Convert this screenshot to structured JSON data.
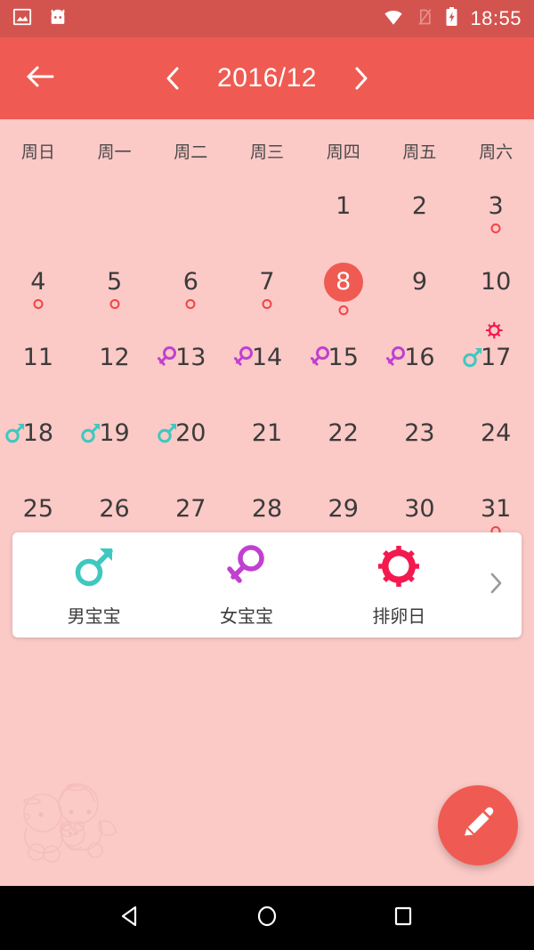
{
  "statusbar": {
    "time": "18:55",
    "icons": [
      "screenshot-icon",
      "android-head-icon",
      "wifi-icon",
      "sim-card-off-icon",
      "battery-charging-icon"
    ]
  },
  "appbar": {
    "back_icon": "arrow-left-icon",
    "prev_icon": "chevron-left-icon",
    "next_icon": "chevron-right-icon",
    "month_title": "2016/12",
    "background": "#ef5b52"
  },
  "calendar": {
    "weekdays": [
      "周日",
      "周一",
      "周二",
      "周三",
      "周四",
      "周五",
      "周六"
    ],
    "leading_blanks": 4,
    "background": "#fbc9c6",
    "today": 8,
    "days": [
      {
        "n": 1
      },
      {
        "n": 2
      },
      {
        "n": 3,
        "dot": true
      },
      {
        "n": 4,
        "dot": true
      },
      {
        "n": 5,
        "dot": true
      },
      {
        "n": 6,
        "dot": true
      },
      {
        "n": 7,
        "dot": true
      },
      {
        "n": 8,
        "dot": true,
        "today": true
      },
      {
        "n": 9
      },
      {
        "n": 10
      },
      {
        "n": 11
      },
      {
        "n": 12
      },
      {
        "n": 13,
        "mark": "female"
      },
      {
        "n": 14,
        "mark": "female"
      },
      {
        "n": 15,
        "mark": "female"
      },
      {
        "n": 16,
        "mark": "female"
      },
      {
        "n": 17,
        "mark": "male",
        "ovulation": true
      },
      {
        "n": 18,
        "mark": "male"
      },
      {
        "n": 19,
        "mark": "male"
      },
      {
        "n": 20,
        "mark": "male"
      },
      {
        "n": 21
      },
      {
        "n": 22
      },
      {
        "n": 23
      },
      {
        "n": 24
      },
      {
        "n": 25
      },
      {
        "n": 26
      },
      {
        "n": 27
      },
      {
        "n": 28
      },
      {
        "n": 29
      },
      {
        "n": 30
      },
      {
        "n": 31,
        "dot": true
      }
    ]
  },
  "legend": {
    "items": [
      {
        "label": "男宝宝",
        "icon": "male-symbol-icon",
        "color": "#3ec8bf"
      },
      {
        "label": "女宝宝",
        "icon": "female-symbol-icon",
        "color": "#c040d0"
      },
      {
        "label": "排卵日",
        "icon": "ovulation-sun-icon",
        "color": "#f4194f"
      }
    ],
    "more_icon": "chevron-right-icon"
  },
  "fab": {
    "icon": "pencil-edit-icon",
    "color": "#ef5b52"
  },
  "navbar": {
    "back_icon": "nav-back-triangle-icon",
    "home_icon": "nav-home-circle-icon",
    "recents_icon": "nav-recents-square-icon"
  },
  "colors": {
    "status_bar": "#d3544f",
    "app_bar": "#ef5b52",
    "calendar_bg": "#fbc9c6",
    "accent_red": "#ef5b52",
    "male_teal": "#3ec8bf",
    "female_purple": "#c040d0",
    "ovulation_pink": "#f4194f",
    "day_text": "#3b3b3b"
  }
}
